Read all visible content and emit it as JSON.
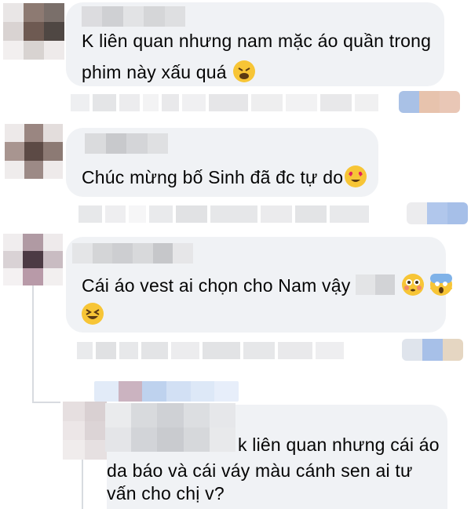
{
  "comments": [
    {
      "id": "c1",
      "lines": [
        "K liên quan nhưng nam mặc áo quần trong",
        "phim này xấu quá"
      ],
      "emoji": [
        "weary-face"
      ]
    },
    {
      "id": "c2",
      "lines": [
        "Chúc mừng bố Sinh đã đc tự do"
      ],
      "emoji": [
        "heart-eyes-face"
      ]
    },
    {
      "id": "c3",
      "lines": [
        "Cái áo vest ai chọn cho Nam vậy"
      ],
      "emoji": [
        "flushed-face",
        "screaming-face",
        "laughing-face"
      ]
    },
    {
      "id": "c4",
      "lines": [
        "k liên quan nhưng cái áo",
        "da báo và cái váy màu cánh sen ai tư",
        "vấn cho chị v?"
      ]
    }
  ],
  "colors": {
    "bubble": "#f0f2f5",
    "text": "#050505",
    "thread_line": "#d8dbe0"
  }
}
